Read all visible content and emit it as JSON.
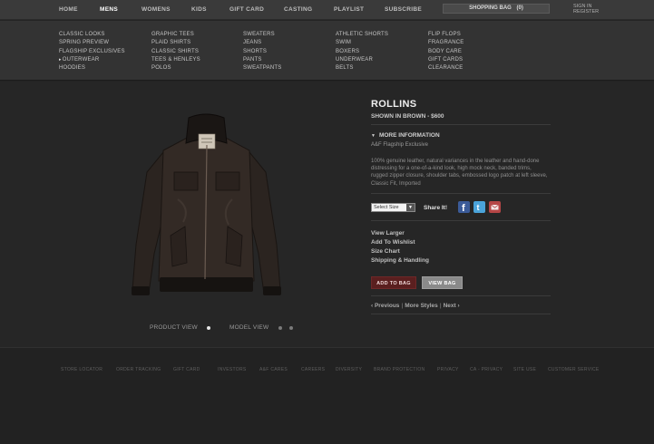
{
  "topnav": {
    "items": [
      {
        "label": "HOME"
      },
      {
        "label": "MENS",
        "active": true
      },
      {
        "label": "WOMENS"
      },
      {
        "label": "KIDS"
      },
      {
        "label": "GIFT CARD"
      },
      {
        "label": "CASTING"
      },
      {
        "label": "PLAYLIST"
      },
      {
        "label": "SUBSCRIBE"
      }
    ],
    "bag_label": "SHOPPING BAG",
    "bag_count": "(0)",
    "sign_in": "SIGN IN",
    "register": "REGISTER"
  },
  "mega_menu": {
    "columns": [
      [
        "CLASSIC LOOKS",
        "SPRING PREVIEW",
        "FLAGSHIP EXCLUSIVES",
        "OUTERWEAR",
        "HOODIES"
      ],
      [
        "GRAPHIC TEES",
        "PLAID SHIRTS",
        "CLASSIC SHIRTS",
        "TEES & HENLEYS",
        "POLOS"
      ],
      [
        "SWEATERS",
        "JEANS",
        "SHORTS",
        "PANTS",
        "SWEATPANTS"
      ],
      [
        "ATHLETIC SHORTS",
        "SWIM",
        "BOXERS",
        "UNDERWEAR",
        "BELTS"
      ],
      [
        "FLIP FLOPS",
        "FRAGRANCE",
        "BODY CARE",
        "GIFT CARDS",
        "CLEARANCE"
      ]
    ],
    "selected": "OUTERWEAR"
  },
  "product": {
    "name": "ROLLINS",
    "shown_in": "SHOWN IN BROWN - $600",
    "more_info": "MORE INFORMATION",
    "flagship": "A&F Flagship Exclusive",
    "description": "100% genuine leather, natural variances in the leather and hand-done distressing for a one-of-a-kind look, high mock neck, banded trims, rugged zipper closure, shoulder tabs, embossed logo patch at left sleeve, Classic Fit, Imported",
    "size_select": "Select Size",
    "share_label": "Share It!",
    "links": [
      "View Larger",
      "Add To Wishlist",
      "Size Chart",
      "Shipping & Handling"
    ],
    "add_to_bag": "ADD TO BAG",
    "view_bag": "VIEW BAG",
    "pager": {
      "previous": "‹ Previous",
      "more": "More Styles",
      "next": "Next ›"
    },
    "colors": {
      "jacket": "#2b2420",
      "add_button": "#5a1f1f"
    }
  },
  "views": {
    "product_view": "PRODUCT VIEW",
    "model_view": "MODEL VIEW"
  },
  "footer": {
    "links": [
      "STORE LOCATOR",
      "ORDER TRACKING",
      "GIFT CARD",
      "INVESTORS",
      "A&F CARES",
      "CAREERS",
      "DIVERSITY",
      "BRAND PROTECTION",
      "PRIVACY",
      "CA - PRIVACY",
      "SITE USE",
      "CUSTOMER SERVICE"
    ]
  }
}
